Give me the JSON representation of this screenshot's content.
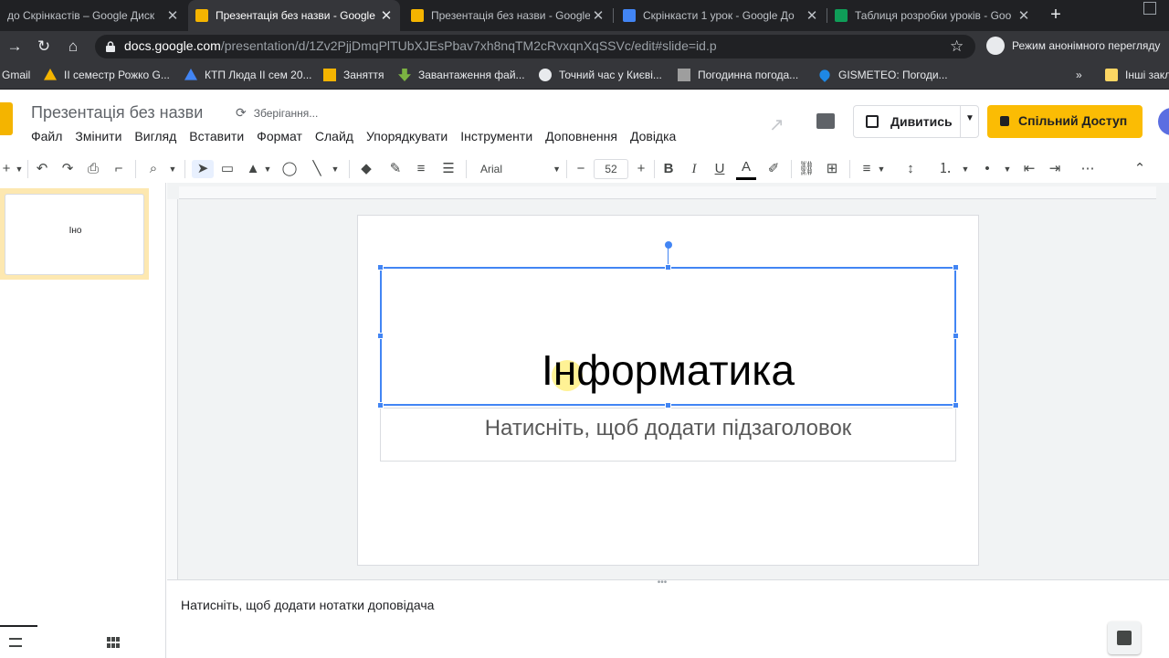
{
  "browser": {
    "tabs": [
      {
        "title": "до Скрінкастів – Google Диск",
        "active": false
      },
      {
        "title": "Презентація без назви - Google",
        "active": true
      },
      {
        "title": "Презентація без назви - Google",
        "active": false
      },
      {
        "title": "Скрінкасти 1 урок - Google До",
        "active": false
      },
      {
        "title": "Таблиця розробки уроків - Goo",
        "active": false
      }
    ],
    "new_tab_label": "+",
    "url_host": "docs.google.com",
    "url_path": "/presentation/d/1Zv2PjjDmqPlTUbXJEsPbav7xh8nqTM2cRvxqnXqSSVc/edit#slide=id.p",
    "incognito_label": "Режим анонімного перегляду",
    "bookmarks": [
      "Gmail",
      "ІІ семестр Рожко G...",
      "КТП Люда ІІ сем 20...",
      "Заняття",
      "Завантаження фай...",
      "Точний час у Києві...",
      "Погодинна погода...",
      "GISMETEO: Погоди..."
    ],
    "bookmarks_overflow": "»",
    "other_bookmarks": "Інші закл"
  },
  "doc": {
    "title": "Презентація без назви",
    "saving_status": "Зберігання..."
  },
  "menu": [
    "Файл",
    "Змінити",
    "Вигляд",
    "Вставити",
    "Формат",
    "Слайд",
    "Упорядкувати",
    "Інструменти",
    "Доповнення",
    "Довідка"
  ],
  "header_buttons": {
    "present": "Дивитись",
    "share": "Спільний Доступ"
  },
  "toolbar": {
    "font": "Arial",
    "font_size": "52",
    "bold": "B",
    "italic": "I",
    "underline": "U",
    "text_color": "A"
  },
  "slides": [
    {
      "thumb_text": "Іно"
    }
  ],
  "slide": {
    "title": "Інформатика",
    "subtitle_placeholder": "Натисніть, щоб додати підзаголовок"
  },
  "notes": {
    "placeholder": "Натисніть, щоб додати нотатки доповідача"
  },
  "colors": {
    "accent_yellow": "#fbbc04",
    "selection_blue": "#4285f4",
    "chrome_dark": "#202124"
  }
}
